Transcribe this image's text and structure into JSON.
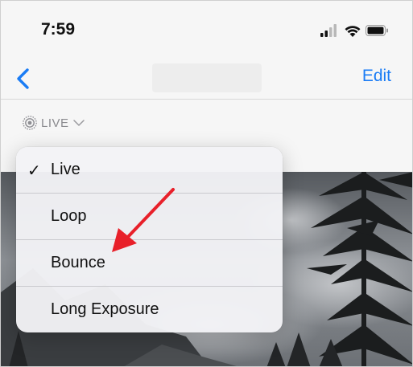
{
  "status_bar": {
    "time": "7:59",
    "icons": [
      "cellular-signal-icon",
      "wifi-icon",
      "battery-icon"
    ]
  },
  "nav": {
    "back_icon": "chevron-left-icon",
    "edit_label": "Edit"
  },
  "live_badge": {
    "label": "LIVE",
    "icon": "live-photo-icon",
    "chevron": "chevron-down-icon"
  },
  "menu": {
    "items": [
      {
        "label": "Live",
        "checked": true
      },
      {
        "label": "Loop",
        "checked": false
      },
      {
        "label": "Bounce",
        "checked": false
      },
      {
        "label": "Long Exposure",
        "checked": false
      }
    ],
    "check_glyph": "✓"
  },
  "colors": {
    "accent": "#1a7cf5",
    "annotation_arrow": "#e8202a"
  }
}
